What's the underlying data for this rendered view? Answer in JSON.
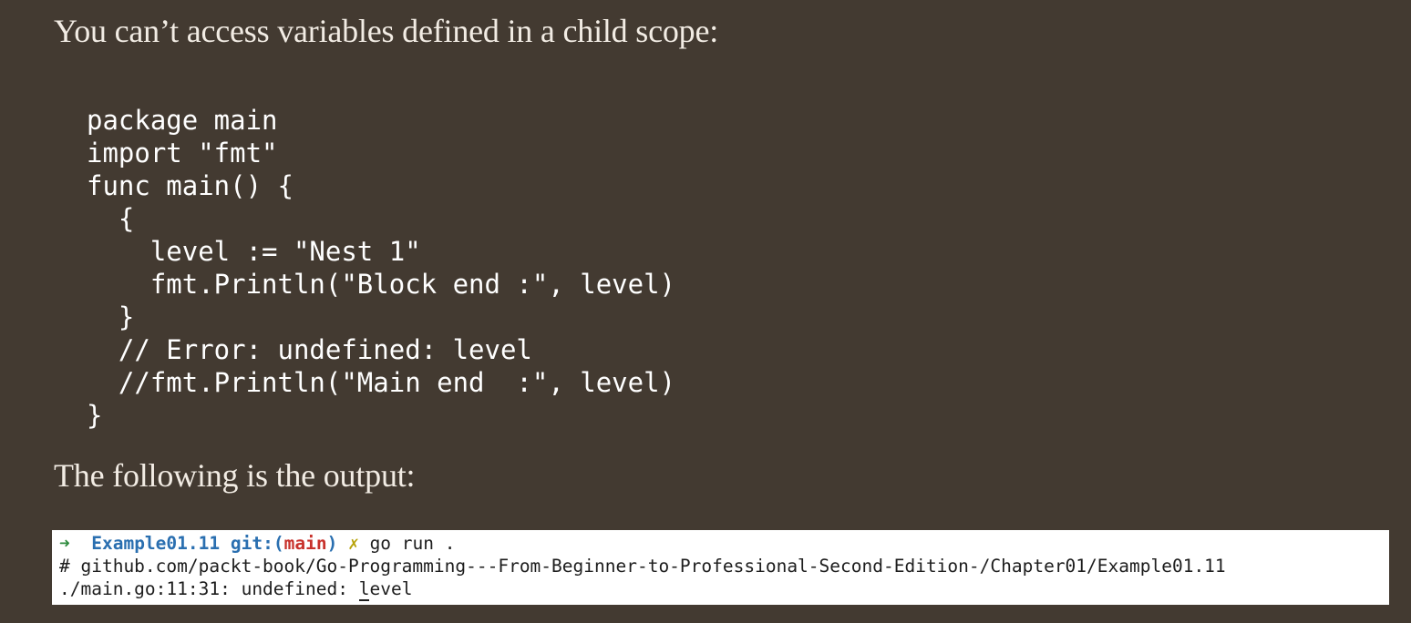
{
  "intro_text": "You can’t access variables defined in a child scope:",
  "code_lines": [
    "package main",
    "import \"fmt\"",
    "func main() {",
    "  {",
    "    level := \"Nest 1\"",
    "    fmt.Println(\"Block end :\", level)",
    "  }",
    "  // Error: undefined: level",
    "  //fmt.Println(\"Main end  :\", level)",
    "}"
  ],
  "outro_text": "The following is the output:",
  "terminal": {
    "prompt_arrow": "➜",
    "directory": "Example01.11",
    "git_label": "git:",
    "branch_open": "(",
    "branch": "main",
    "branch_close": ")",
    "dirty_mark": "✗",
    "command": "go run .",
    "output_line_1": "# github.com/packt-book/Go-Programming---From-Beginner-to-Professional-Second-Edition-/Chapter01/Example01.11",
    "output_line_2_prefix": "./main.go:11:31: undefined: ",
    "output_line_2_cursor": "l",
    "output_line_2_suffix": "evel"
  },
  "colors": {
    "page_background": "#433a31",
    "text": "#f2ece4",
    "terminal_background": "#ffffff",
    "prompt_arrow": "#2e8b3e",
    "directory": "#2a6fb0",
    "branch": "#c8322c",
    "dirty_mark": "#b8a30a"
  }
}
